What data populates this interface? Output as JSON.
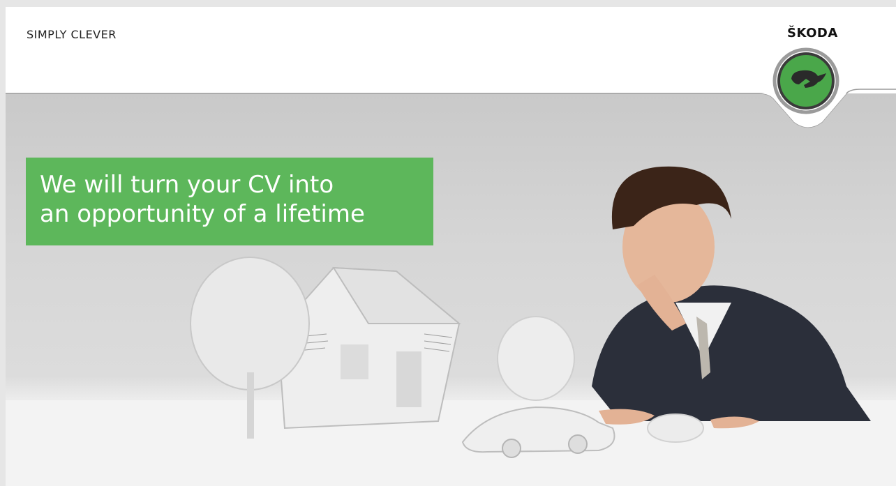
{
  "header": {
    "tagline": "SIMPLY CLEVER",
    "brand_name": "ŠKODA"
  },
  "headline": {
    "line1": "We will turn your CV into",
    "line2": "an opportunity of a lifetime"
  },
  "colors": {
    "headline_bg": "#5db75b",
    "logo_green": "#4aa74a",
    "page_bg": "#e6e6e6"
  },
  "icons": [
    "skoda-winged-arrow-logo-icon"
  ]
}
